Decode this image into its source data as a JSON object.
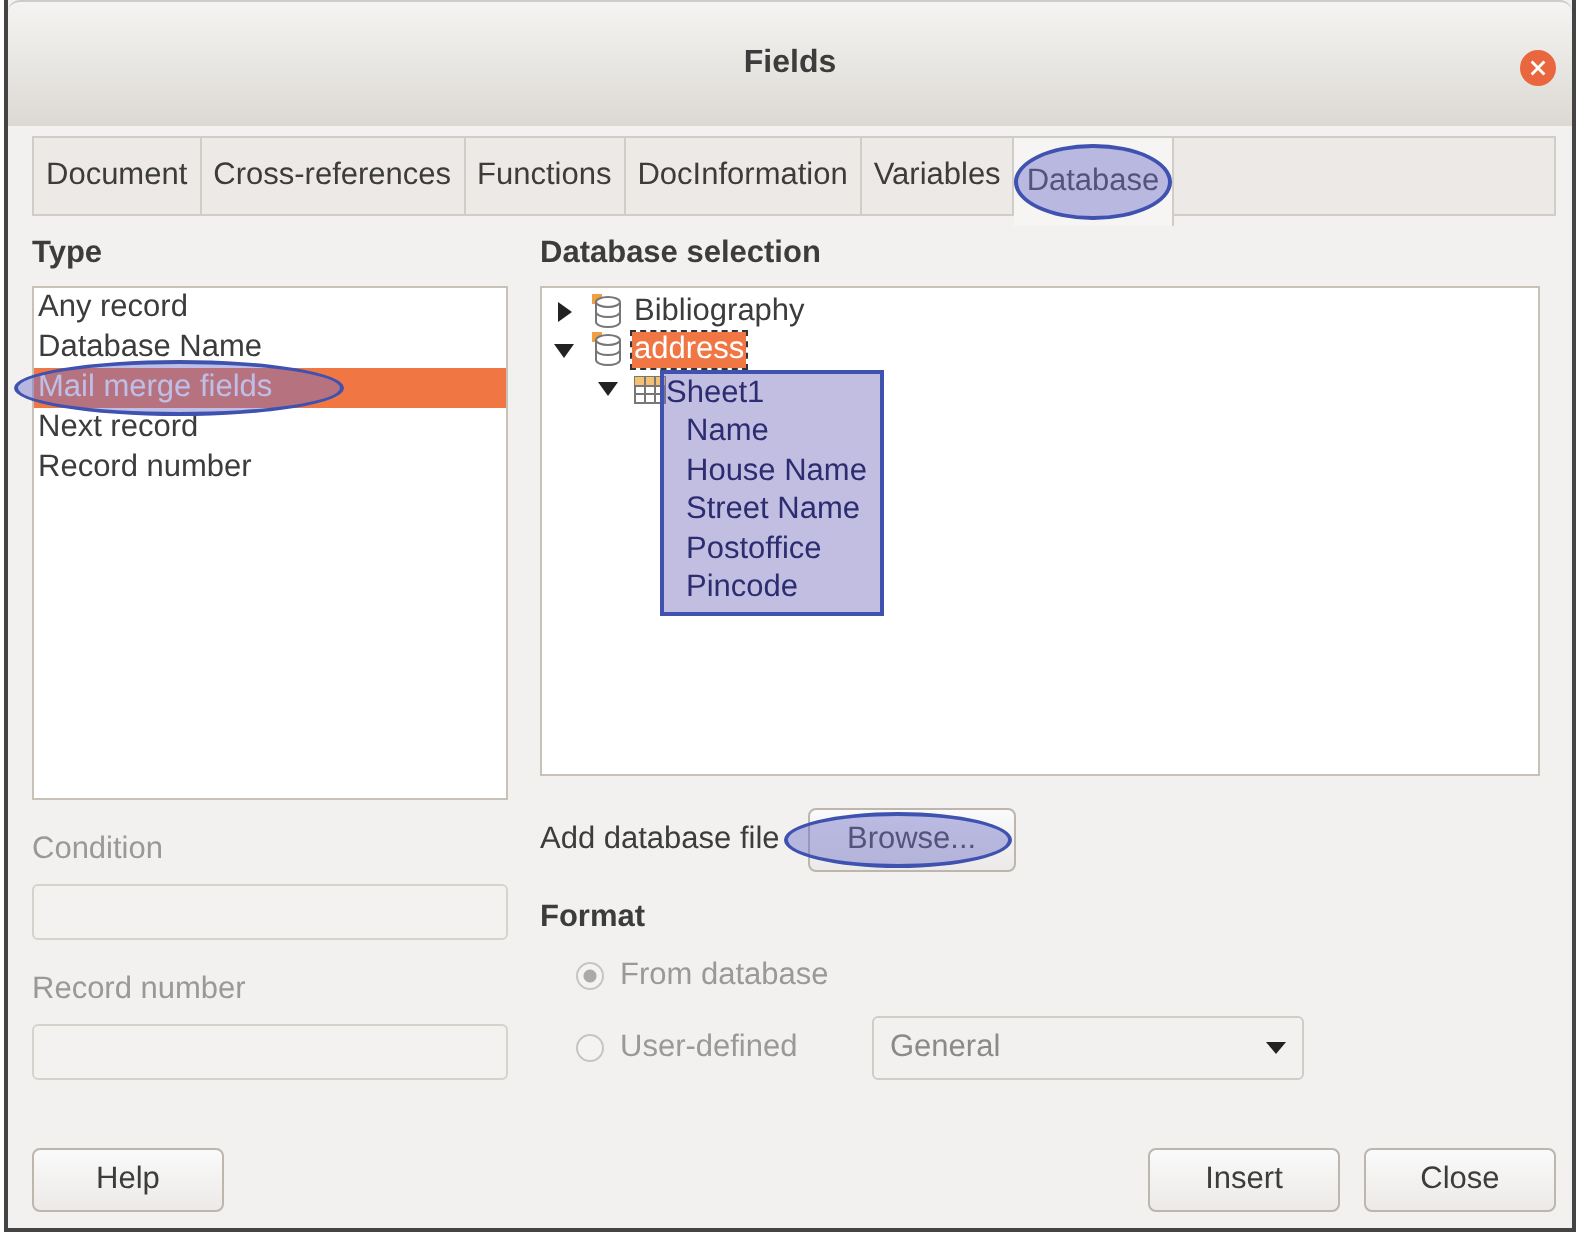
{
  "window": {
    "title": "Fields"
  },
  "tabs": [
    {
      "label": "Document",
      "selected": false,
      "highlighted": false
    },
    {
      "label": "Cross-references",
      "selected": false,
      "highlighted": false
    },
    {
      "label": "Functions",
      "selected": false,
      "highlighted": false
    },
    {
      "label": "DocInformation",
      "selected": false,
      "highlighted": false
    },
    {
      "label": "Variables",
      "selected": false,
      "highlighted": false
    },
    {
      "label": "Database",
      "selected": true,
      "highlighted": true
    }
  ],
  "type": {
    "heading": "Type",
    "items": [
      {
        "label": "Any record",
        "selected": false
      },
      {
        "label": "Database Name",
        "selected": false
      },
      {
        "label": "Mail merge fields",
        "selected": true,
        "highlighted": true
      },
      {
        "label": "Next record",
        "selected": false
      },
      {
        "label": "Record number",
        "selected": false
      }
    ]
  },
  "database_selection": {
    "heading": "Database selection",
    "tree": [
      {
        "label": "Bibliography",
        "kind": "database",
        "expanded": false,
        "selected": false
      },
      {
        "label": "address",
        "kind": "database",
        "expanded": true,
        "selected": true,
        "children": [
          {
            "label": "Sheet1",
            "kind": "table",
            "expanded": true,
            "selected": false,
            "highlighted": true,
            "children": [
              {
                "label": "Name",
                "selected": false
              },
              {
                "label": "House Name",
                "selected": false
              },
              {
                "label": "Street Name",
                "selected": false
              },
              {
                "label": "Postoffice",
                "selected": false
              },
              {
                "label": "Pincode",
                "selected": false
              }
            ]
          }
        ]
      }
    ]
  },
  "condition": {
    "label": "Condition",
    "disabled": true
  },
  "record_number": {
    "label": "Record number",
    "disabled": true
  },
  "add_database_file": {
    "label": "Add database file",
    "button": "Browse...",
    "highlighted": true
  },
  "format": {
    "heading": "Format",
    "options": [
      {
        "label": "From database",
        "selected": true,
        "disabled": true
      },
      {
        "label": "User-defined",
        "selected": false,
        "disabled": true
      }
    ],
    "dropdown": {
      "value": "General",
      "disabled": true
    }
  },
  "buttons": {
    "help": "Help",
    "insert": "Insert",
    "close": "Close"
  }
}
